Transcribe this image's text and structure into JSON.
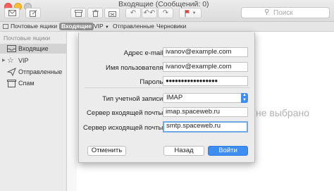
{
  "window": {
    "title": "Входящие (Сообщений: 0)"
  },
  "toolbar": {
    "search_placeholder": "Поиск",
    "icons": [
      "compose-icon",
      "archive-icon",
      "trash-icon",
      "junk-icon",
      "reply-icon",
      "reply-all-icon",
      "forward-icon",
      "flag-icon",
      "chevron-down-icon",
      "search-icon"
    ]
  },
  "favorites": {
    "mailboxes": "Почтовые ящики",
    "inbox": "Входящие",
    "vip": "VIP",
    "sent": "Отправленные",
    "drafts": "Черновики"
  },
  "sidebar": {
    "heading": "Почтовые ящики",
    "items": [
      {
        "label": "Входящие",
        "icon": "inbox-icon"
      },
      {
        "label": "VIP",
        "icon": "star-icon"
      },
      {
        "label": "Отправленные",
        "icon": "paper-plane-icon"
      },
      {
        "label": "Спам",
        "icon": "junk-icon"
      }
    ]
  },
  "preview": {
    "no_selection": "не выбрано"
  },
  "dialog": {
    "email_label": "Адрес e-mail:",
    "email_value": "ivanov@example.com",
    "username_label": "Имя пользователя:",
    "username_value": "ivanov@example.com",
    "password_label": "Пароль:",
    "password_value": "●●●●●●●●●●●●●●●●●",
    "account_type_label": "Тип учетной записи:",
    "account_type_value": "IMAP",
    "incoming_label": "Сервер входящей почты:",
    "incoming_value": "imap.spaceweb.ru",
    "outgoing_label": "Сервер исходящей почты:",
    "outgoing_value": "smtp.spaceweb.ru",
    "cancel": "Отменить",
    "back": "Назад",
    "login": "Войти"
  },
  "colors": {
    "accent": "#3d8ef0",
    "focus_ring": "#6fa8e6"
  }
}
